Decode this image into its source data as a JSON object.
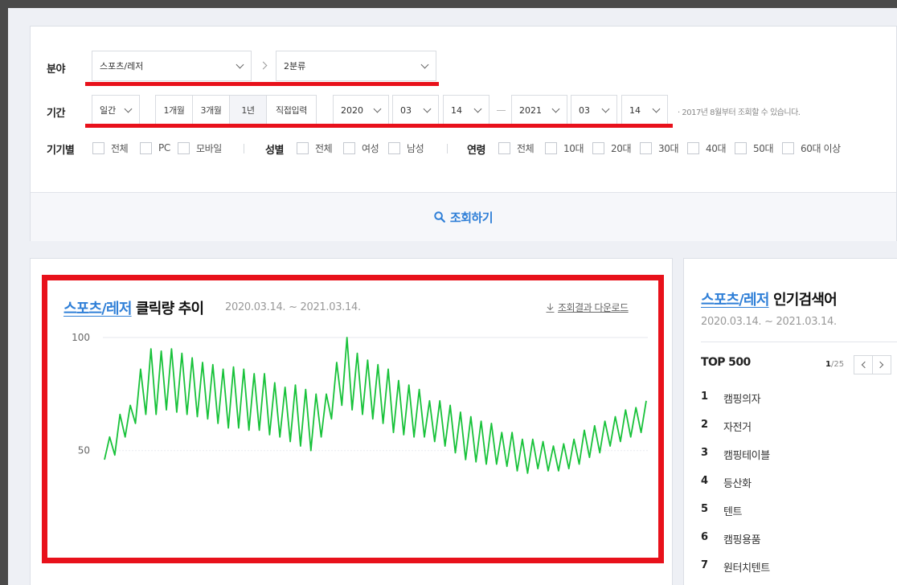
{
  "filters": {
    "category_label": "분야",
    "category_1": "스포츠/레저",
    "category_2": "2분류",
    "period_label": "기간",
    "period_unit": "일간",
    "period_buttons": [
      "1개월",
      "3개월",
      "1년",
      "직접입력"
    ],
    "period_active": "1년",
    "start_year": "2020",
    "start_month": "03",
    "start_day": "14",
    "end_year": "2021",
    "end_month": "03",
    "end_day": "14",
    "note": "· 2017년 8월부터 조회할 수 있습니다.",
    "device_label": "기기별",
    "device_options": [
      "전체",
      "PC",
      "모바일"
    ],
    "gender_label": "성별",
    "gender_options": [
      "전체",
      "여성",
      "남성"
    ],
    "age_label": "연령",
    "age_options": [
      "전체",
      "10대",
      "20대",
      "30대",
      "40대",
      "50대",
      "60대 이상"
    ],
    "search_button": "조회하기"
  },
  "chart_panel": {
    "title_highlight": "스포츠/레저",
    "title_rest": " 클릭량 추이",
    "date_range": "2020.03.14. ~ 2021.03.14.",
    "download_label": "조회결과 다운로드"
  },
  "chart_data": {
    "type": "line",
    "ylim": [
      30,
      100
    ],
    "yticks": [
      50,
      100
    ],
    "series": [
      {
        "color": "#18c23a",
        "x": [
          "2020-03-14",
          "2020-03-21",
          "2020-03-28",
          "2020-04-04",
          "2020-04-11",
          "2020-04-18",
          "2020-04-25",
          "2020-05-02",
          "2020-05-09",
          "2020-05-16",
          "2020-05-23",
          "2020-05-30",
          "2020-06-06",
          "2020-06-13",
          "2020-06-20",
          "2020-06-27",
          "2020-07-04",
          "2020-07-11",
          "2020-07-18",
          "2020-07-25",
          "2020-08-01",
          "2020-08-08",
          "2020-08-15",
          "2020-08-22",
          "2020-08-29",
          "2020-09-05",
          "2020-09-12",
          "2020-09-19",
          "2020-09-26",
          "2020-10-03",
          "2020-10-10",
          "2020-10-17",
          "2020-10-24",
          "2020-10-31",
          "2020-11-07",
          "2020-11-14",
          "2020-11-21",
          "2020-11-28",
          "2020-12-05",
          "2020-12-12",
          "2020-12-19",
          "2020-12-26",
          "2021-01-02",
          "2021-01-09",
          "2021-01-16",
          "2021-01-23",
          "2021-01-30",
          "2021-02-06",
          "2021-02-13",
          "2021-02-20",
          "2021-02-27",
          "2021-03-06",
          "2021-03-13"
        ],
        "peaks": [
          56,
          66,
          70,
          86,
          95,
          94,
          95,
          93,
          91,
          89,
          88,
          86,
          87,
          86,
          84,
          84,
          80,
          78,
          79,
          77,
          75,
          75,
          89,
          100,
          93,
          90,
          88,
          86,
          81,
          79,
          77,
          72,
          72,
          70,
          67,
          65,
          63,
          62,
          58,
          58,
          55,
          55,
          54,
          52,
          53,
          55,
          59,
          61,
          63,
          65,
          68,
          69,
          72
        ],
        "troughs": [
          46,
          48,
          56,
          62,
          66,
          66,
          68,
          67,
          66,
          65,
          64,
          62,
          60,
          60,
          59,
          59,
          57,
          56,
          54,
          52,
          50,
          56,
          64,
          70,
          68,
          66,
          64,
          62,
          58,
          57,
          56,
          56,
          54,
          52,
          49,
          46,
          45,
          44,
          44,
          43,
          41,
          40,
          42,
          41,
          41,
          42,
          44,
          47,
          49,
          52,
          54,
          56,
          58
        ]
      }
    ]
  },
  "keywords": {
    "title_highlight": "스포츠/레저",
    "title_rest": " 인기검색어",
    "date_range": "2020.03.14. ~ 2021.03.14.",
    "top_label": "TOP 500",
    "page_current": "1",
    "page_total": "/25",
    "items": [
      {
        "rank": "1",
        "name": "캠핑의자"
      },
      {
        "rank": "2",
        "name": "자전거"
      },
      {
        "rank": "3",
        "name": "캠핑테이블"
      },
      {
        "rank": "4",
        "name": "등산화"
      },
      {
        "rank": "5",
        "name": "텐트"
      },
      {
        "rank": "6",
        "name": "캠핑용품"
      },
      {
        "rank": "7",
        "name": "원터치텐트"
      }
    ]
  },
  "colors": {
    "accent": "#2f7fd7",
    "highlight_red": "#e8111b",
    "line": "#18c23a"
  }
}
